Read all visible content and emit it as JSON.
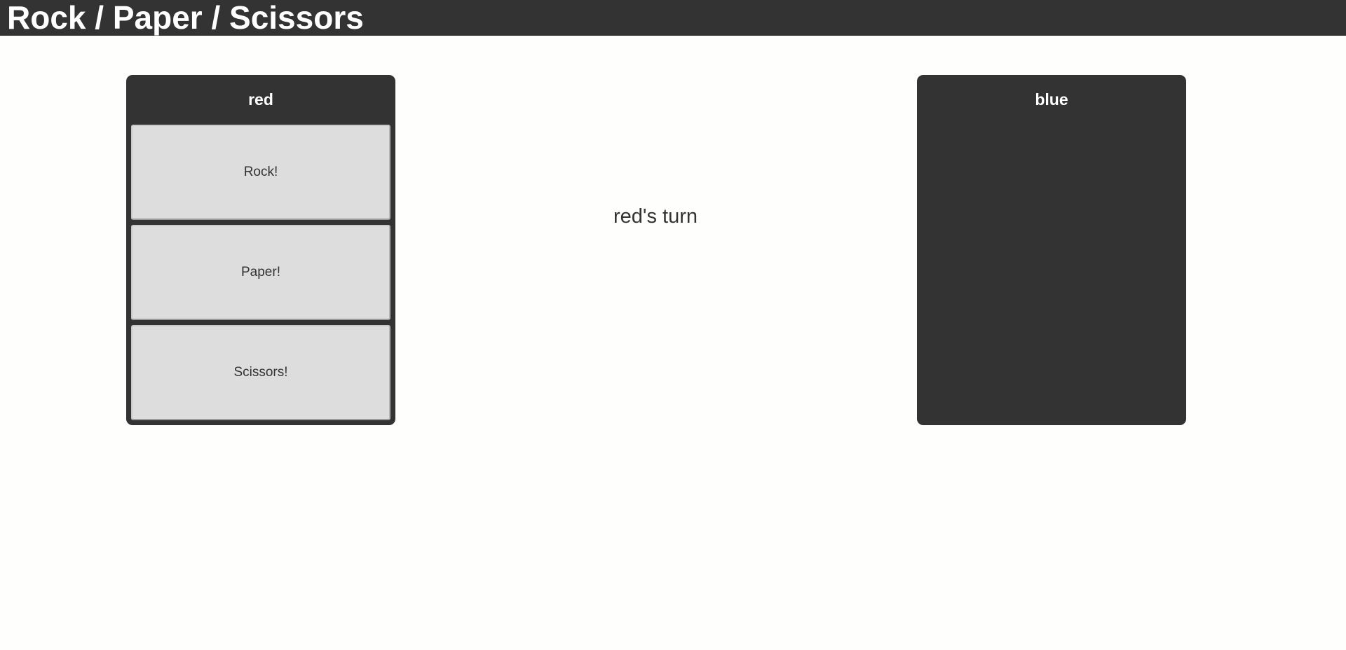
{
  "header": {
    "title": "Rock / Paper / Scissors"
  },
  "players": {
    "red": {
      "name": "red",
      "moves": [
        "Rock!",
        "Paper!",
        "Scissors!"
      ]
    },
    "blue": {
      "name": "blue"
    }
  },
  "status": {
    "turn_text": "red's turn"
  },
  "colors": {
    "header_bg": "#333333",
    "panel_bg": "#333333",
    "button_bg": "#dddddd",
    "page_bg": "#fefefd",
    "text_dark": "#333333",
    "text_light": "#ffffff"
  }
}
